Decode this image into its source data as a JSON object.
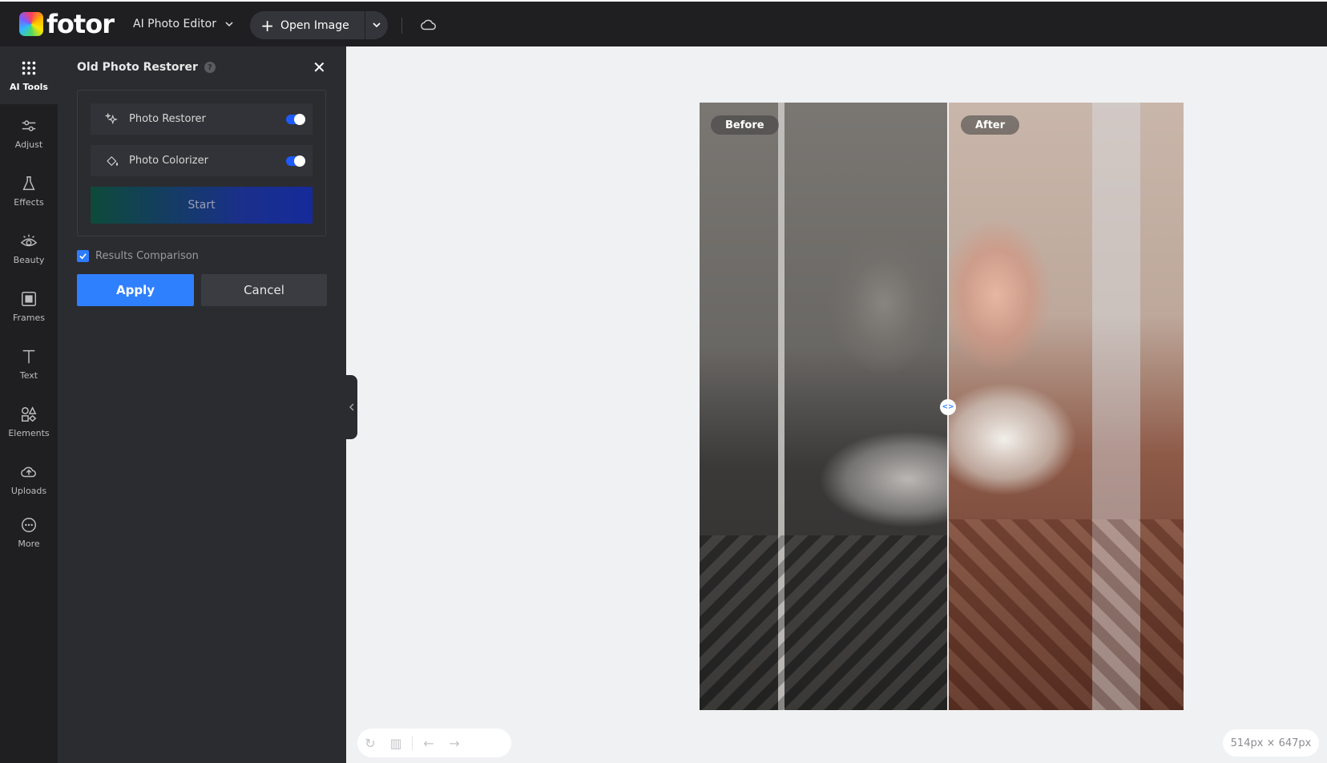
{
  "app": {
    "logo_text": "fotor",
    "mode_menu": "AI Photo Editor",
    "open_image": "Open Image"
  },
  "rail": {
    "items": [
      {
        "label": "AI Tools",
        "icon": "grid-dots-icon",
        "active": true
      },
      {
        "label": "Adjust",
        "icon": "sliders-icon"
      },
      {
        "label": "Effects",
        "icon": "flask-icon"
      },
      {
        "label": "Beauty",
        "icon": "eye-icon"
      },
      {
        "label": "Frames",
        "icon": "frame-icon"
      },
      {
        "label": "Text",
        "icon": "text-icon"
      },
      {
        "label": "Elements",
        "icon": "shapes-icon"
      },
      {
        "label": "Uploads",
        "icon": "cloud-upload-icon"
      },
      {
        "label": "More",
        "icon": "more-icon"
      }
    ]
  },
  "panel": {
    "title": "Old Photo Restorer",
    "help": "?",
    "options": [
      {
        "label": "Photo Restorer",
        "enabled": true,
        "icon": "sparkle-icon"
      },
      {
        "label": "Photo Colorizer",
        "enabled": true,
        "icon": "paint-bucket-icon"
      }
    ],
    "start_label": "Start",
    "comparison_label": "Results Comparison",
    "comparison_checked": true,
    "apply_label": "Apply",
    "cancel_label": "Cancel"
  },
  "canvas": {
    "before_label": "Before",
    "after_label": "After",
    "comparison_position": 0.51
  },
  "status": {
    "size": "514px × 647px"
  },
  "colors": {
    "accent": "#2f80ff",
    "toggle_on": "#1d5bff",
    "dark_bg": "#1f1f22",
    "panel_bg": "#2b2c30"
  }
}
